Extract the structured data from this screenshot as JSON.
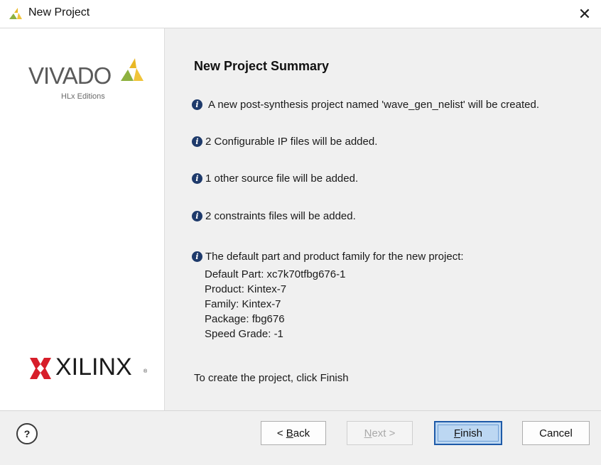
{
  "window": {
    "title": "New Project",
    "close_glyph": "✕"
  },
  "brand": {
    "vivado_word": "VIVADO",
    "vivado_sub": "HLx Editions",
    "xilinx_word": "XILINX",
    "xilinx_reg": "®"
  },
  "summary": {
    "title": "New Project Summary",
    "lines": [
      "A new post-synthesis project named 'wave_gen_nelist' will be created.",
      "2 Configurable IP files will be added.",
      "1 other source file will be added.",
      "2 constraints files will be added.",
      "The default part and product family for the new project:"
    ],
    "part_details": [
      "Default Part: xc7k70tfbg676-1",
      "Product: Kintex-7",
      "Family: Kintex-7",
      "Package: fbg676",
      "Speed Grade: -1"
    ],
    "finish_hint": "To create the project, click Finish"
  },
  "footer": {
    "help_label": "?",
    "back_prefix": "< ",
    "back_mnemonic": "B",
    "back_rest": "ack",
    "next_mnemonic": "N",
    "next_rest": "ext >",
    "finish_mnemonic": "F",
    "finish_rest": "inish",
    "cancel_label": "Cancel"
  },
  "icons": {
    "app": "vivado-app-icon",
    "info": "info-icon",
    "help": "help-icon",
    "close": "close-icon"
  },
  "colors": {
    "info_icon": "#1e3a6b",
    "accent_finish": "#1e5aa8",
    "vivado_green": "#8db13f",
    "vivado_yellow": "#e9b825",
    "xilinx_red": "#d71e2a"
  }
}
